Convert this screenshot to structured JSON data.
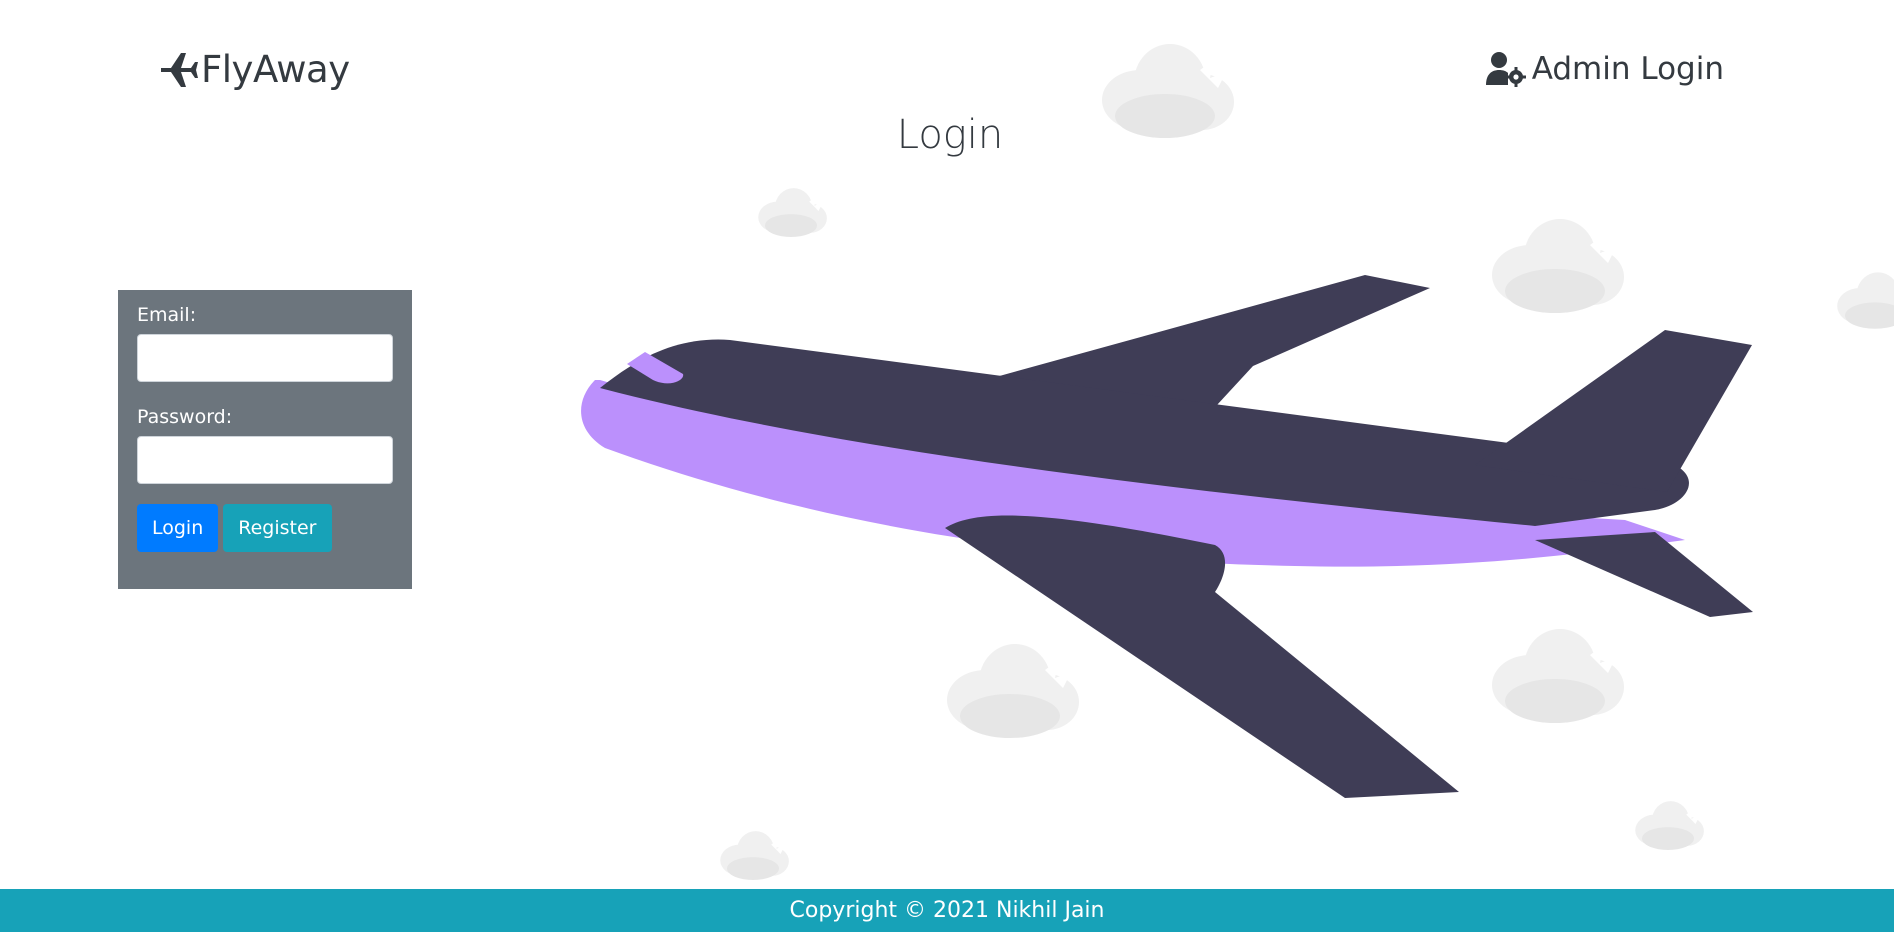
{
  "brand": {
    "icon": "airplane-icon",
    "name": "FlyAway"
  },
  "nav": {
    "admin_icon": "user-gear-icon",
    "admin_label": "Admin Login"
  },
  "page": {
    "title": "Login"
  },
  "form": {
    "email_label": "Email:",
    "email_value": "",
    "password_label": "Password:",
    "password_value": "",
    "login_button": "Login",
    "register_button": "Register"
  },
  "footer": {
    "text": "Copyright © 2021 Nikhil Jain"
  },
  "colors": {
    "panel": "#6c757d",
    "primary": "#007bff",
    "info": "#17a2b8",
    "plane_body": "#3f3d56",
    "plane_accent": "#bb90fc",
    "cloud": "#f0f0f0"
  }
}
